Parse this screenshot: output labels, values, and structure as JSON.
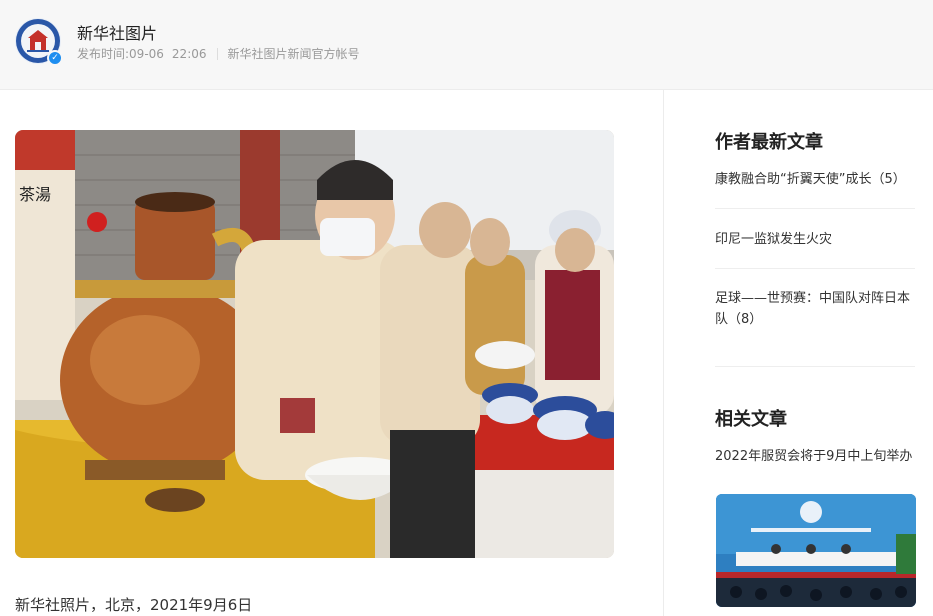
{
  "account": {
    "name": "新华社图片",
    "publish_label": "发布时间:",
    "publish_date": "09-06",
    "publish_time": "22:06",
    "description": "新华社图片新闻官方帐号",
    "avatar_icon": "xinhua-logo-icon",
    "verified_icon": "verified-check-icon"
  },
  "article": {
    "photo_alt": "news-photo",
    "caption": "新华社照片，北京，2021年9月6日"
  },
  "sidebar": {
    "latest_title": "作者最新文章",
    "latest": [
      {
        "label": "康教融合助“折翼天使”成长（5）"
      },
      {
        "label": "印尼一监狱发生火灾"
      },
      {
        "label": "足球——世预赛：中国队对阵日本队（8）"
      }
    ],
    "related_title": "相关文章",
    "related": [
      {
        "label": "2022年服贸会将于9月中上旬举办"
      }
    ]
  },
  "colors": {
    "header_bg": "#f7f7f7",
    "verified": "#1e8ef0",
    "text_main": "#333333",
    "text_meta": "#999999"
  }
}
